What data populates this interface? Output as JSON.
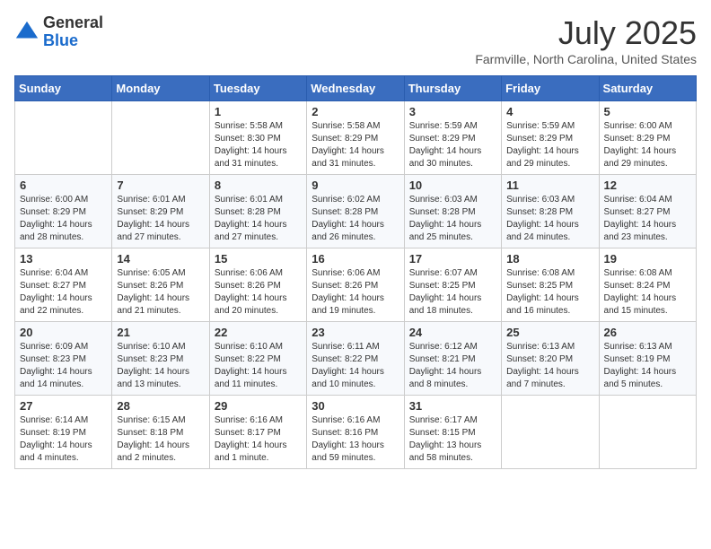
{
  "header": {
    "logo_general": "General",
    "logo_blue": "Blue",
    "title": "July 2025",
    "location": "Farmville, North Carolina, United States"
  },
  "days_of_week": [
    "Sunday",
    "Monday",
    "Tuesday",
    "Wednesday",
    "Thursday",
    "Friday",
    "Saturday"
  ],
  "weeks": [
    [
      {
        "day": null,
        "info": null
      },
      {
        "day": null,
        "info": null
      },
      {
        "day": "1",
        "info": "Sunrise: 5:58 AM\nSunset: 8:30 PM\nDaylight: 14 hours and 31 minutes."
      },
      {
        "day": "2",
        "info": "Sunrise: 5:58 AM\nSunset: 8:29 PM\nDaylight: 14 hours and 31 minutes."
      },
      {
        "day": "3",
        "info": "Sunrise: 5:59 AM\nSunset: 8:29 PM\nDaylight: 14 hours and 30 minutes."
      },
      {
        "day": "4",
        "info": "Sunrise: 5:59 AM\nSunset: 8:29 PM\nDaylight: 14 hours and 29 minutes."
      },
      {
        "day": "5",
        "info": "Sunrise: 6:00 AM\nSunset: 8:29 PM\nDaylight: 14 hours and 29 minutes."
      }
    ],
    [
      {
        "day": "6",
        "info": "Sunrise: 6:00 AM\nSunset: 8:29 PM\nDaylight: 14 hours and 28 minutes."
      },
      {
        "day": "7",
        "info": "Sunrise: 6:01 AM\nSunset: 8:29 PM\nDaylight: 14 hours and 27 minutes."
      },
      {
        "day": "8",
        "info": "Sunrise: 6:01 AM\nSunset: 8:28 PM\nDaylight: 14 hours and 27 minutes."
      },
      {
        "day": "9",
        "info": "Sunrise: 6:02 AM\nSunset: 8:28 PM\nDaylight: 14 hours and 26 minutes."
      },
      {
        "day": "10",
        "info": "Sunrise: 6:03 AM\nSunset: 8:28 PM\nDaylight: 14 hours and 25 minutes."
      },
      {
        "day": "11",
        "info": "Sunrise: 6:03 AM\nSunset: 8:28 PM\nDaylight: 14 hours and 24 minutes."
      },
      {
        "day": "12",
        "info": "Sunrise: 6:04 AM\nSunset: 8:27 PM\nDaylight: 14 hours and 23 minutes."
      }
    ],
    [
      {
        "day": "13",
        "info": "Sunrise: 6:04 AM\nSunset: 8:27 PM\nDaylight: 14 hours and 22 minutes."
      },
      {
        "day": "14",
        "info": "Sunrise: 6:05 AM\nSunset: 8:26 PM\nDaylight: 14 hours and 21 minutes."
      },
      {
        "day": "15",
        "info": "Sunrise: 6:06 AM\nSunset: 8:26 PM\nDaylight: 14 hours and 20 minutes."
      },
      {
        "day": "16",
        "info": "Sunrise: 6:06 AM\nSunset: 8:26 PM\nDaylight: 14 hours and 19 minutes."
      },
      {
        "day": "17",
        "info": "Sunrise: 6:07 AM\nSunset: 8:25 PM\nDaylight: 14 hours and 18 minutes."
      },
      {
        "day": "18",
        "info": "Sunrise: 6:08 AM\nSunset: 8:25 PM\nDaylight: 14 hours and 16 minutes."
      },
      {
        "day": "19",
        "info": "Sunrise: 6:08 AM\nSunset: 8:24 PM\nDaylight: 14 hours and 15 minutes."
      }
    ],
    [
      {
        "day": "20",
        "info": "Sunrise: 6:09 AM\nSunset: 8:23 PM\nDaylight: 14 hours and 14 minutes."
      },
      {
        "day": "21",
        "info": "Sunrise: 6:10 AM\nSunset: 8:23 PM\nDaylight: 14 hours and 13 minutes."
      },
      {
        "day": "22",
        "info": "Sunrise: 6:10 AM\nSunset: 8:22 PM\nDaylight: 14 hours and 11 minutes."
      },
      {
        "day": "23",
        "info": "Sunrise: 6:11 AM\nSunset: 8:22 PM\nDaylight: 14 hours and 10 minutes."
      },
      {
        "day": "24",
        "info": "Sunrise: 6:12 AM\nSunset: 8:21 PM\nDaylight: 14 hours and 8 minutes."
      },
      {
        "day": "25",
        "info": "Sunrise: 6:13 AM\nSunset: 8:20 PM\nDaylight: 14 hours and 7 minutes."
      },
      {
        "day": "26",
        "info": "Sunrise: 6:13 AM\nSunset: 8:19 PM\nDaylight: 14 hours and 5 minutes."
      }
    ],
    [
      {
        "day": "27",
        "info": "Sunrise: 6:14 AM\nSunset: 8:19 PM\nDaylight: 14 hours and 4 minutes."
      },
      {
        "day": "28",
        "info": "Sunrise: 6:15 AM\nSunset: 8:18 PM\nDaylight: 14 hours and 2 minutes."
      },
      {
        "day": "29",
        "info": "Sunrise: 6:16 AM\nSunset: 8:17 PM\nDaylight: 14 hours and 1 minute."
      },
      {
        "day": "30",
        "info": "Sunrise: 6:16 AM\nSunset: 8:16 PM\nDaylight: 13 hours and 59 minutes."
      },
      {
        "day": "31",
        "info": "Sunrise: 6:17 AM\nSunset: 8:15 PM\nDaylight: 13 hours and 58 minutes."
      },
      {
        "day": null,
        "info": null
      },
      {
        "day": null,
        "info": null
      }
    ]
  ]
}
